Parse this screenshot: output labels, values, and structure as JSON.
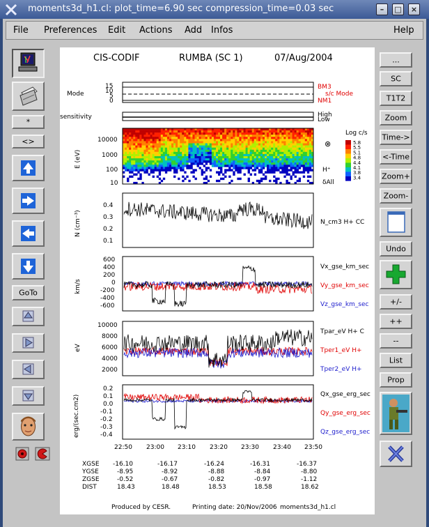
{
  "window": {
    "title": "moments3d_h1.cl: plot_time=6.90 sec  compression_time=0.03 sec"
  },
  "menubar": {
    "file": "File",
    "preferences": "Preferences",
    "edit": "Edit",
    "actions": "Actions",
    "add": "Add",
    "infos": "Infos",
    "help": "Help"
  },
  "left_toolbar": {
    "star": "*",
    "diamond": "<>",
    "goto": "GoTo"
  },
  "right_toolbar": {
    "more": "...",
    "sc": "SC",
    "t1t2": "T1T2",
    "zoom": "Zoom",
    "time_fwd": "Time->",
    "time_back": "<-Time",
    "zoom_plus": "Zoom+",
    "zoom_minus": "Zoom-",
    "undo": "Undo",
    "plus_minus": "+/-",
    "plus_plus": "++",
    "minus_minus": "--",
    "list": "List",
    "prop": "Prop"
  },
  "plot": {
    "header_left": "CIS-CODIF",
    "header_mid": "RUMBA (SC 1)",
    "header_right": "07/Aug/2004",
    "mode": {
      "ylabel": "Mode",
      "ticks": [
        "15",
        "10",
        "5",
        "0"
      ],
      "labels": [
        "BM3",
        "s/c Mode",
        "NM1"
      ]
    },
    "sensitivity": {
      "ylabel": "sensitivity",
      "labels": [
        "High",
        "Low"
      ]
    },
    "energy": {
      "ylabel": "E (eV)",
      "ticks": [
        "10000",
        "1000",
        "100",
        "10"
      ],
      "species": "H⁺",
      "all_label": "δAll",
      "colorbar_title": "Log c/s",
      "colorbar_ticks": [
        "5.8",
        "5.5",
        "5.1",
        "4.8",
        "4.4",
        "4.1",
        "3.8",
        "3.4"
      ]
    },
    "density": {
      "ylabel": "N (cm⁻³)",
      "ticks": [
        "0.4",
        "0.3",
        "0.2",
        "0.1"
      ],
      "label": "N_cm3   H+ CC"
    },
    "velocity": {
      "ylabel": "km/s",
      "ticks": [
        "600",
        "400",
        "200",
        "0",
        "-200",
        "-400",
        "-600"
      ],
      "labels": [
        "Vx_gse_km_sec",
        "Vy_gse_km_sec",
        "Vz_gse_km_sec"
      ]
    },
    "temperature": {
      "ylabel": "eV",
      "ticks": [
        "10000",
        "8000",
        "6000",
        "4000",
        "2000"
      ],
      "labels": [
        "Tpar_eV   H+ C",
        "Tper1_eV   H+",
        "Tper2_eV   H+"
      ]
    },
    "heatflux": {
      "ylabel": "erg/(sec.cm2)",
      "ticks": [
        "0.2",
        "0.1",
        "0.0",
        "-0.1",
        "-0.2",
        "-0.3",
        "-0.4"
      ],
      "labels": [
        "Qx_gse_erg_sec",
        "Qy_gse_erg_sec",
        "Qz_gse_erg_sec"
      ]
    },
    "time_ticks": [
      "22:50",
      "23:00",
      "23:10",
      "23:20",
      "23:30",
      "23:40",
      "23:50"
    ],
    "ephemeris": {
      "rows": [
        {
          "name": "XGSE",
          "values": [
            "-16.10",
            "-16.17",
            "-16.24",
            "-16.31",
            "-16.37"
          ]
        },
        {
          "name": "YGSE",
          "values": [
            "-8.95",
            "-8.92",
            "-8.88",
            "-8.84",
            "-8.80"
          ]
        },
        {
          "name": "ZGSE",
          "values": [
            "-0.52",
            "-0.67",
            "-0.82",
            "-0.97",
            "-1.12"
          ]
        },
        {
          "name": "DIST",
          "values": [
            "18.43",
            "18.48",
            "18.53",
            "18.58",
            "18.62"
          ]
        }
      ]
    },
    "footer": {
      "produced": "Produced by CESR.",
      "printing": "Printing date: 20/Nov/2006",
      "file": "moments3d_h1.cl"
    }
  },
  "colors": {
    "titlebar": "#3c5a96",
    "series_black": "#000000",
    "series_red": "#e00000",
    "series_blue": "#1a1acc"
  }
}
